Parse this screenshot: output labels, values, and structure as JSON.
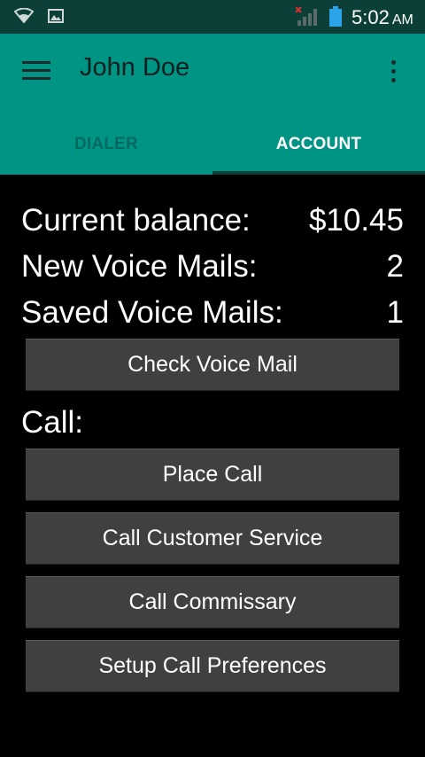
{
  "status_bar": {
    "icons": [
      "wifi-icon",
      "image-icon",
      "signal-icon",
      "battery-icon"
    ],
    "time": "5:02",
    "ampm": "AM"
  },
  "app_bar": {
    "title": "John Doe",
    "menu_icon": "hamburger-menu-icon",
    "overflow_icon": "overflow-menu-icon",
    "background": "#009485"
  },
  "tabs": [
    {
      "label": "DIALER",
      "selected": false
    },
    {
      "label": "ACCOUNT",
      "selected": true
    }
  ],
  "account": {
    "balance_label": "Current balance:",
    "balance_value": "$10.45",
    "new_vm_label": "New Voice Mails:",
    "new_vm_value": "2",
    "saved_vm_label": "Saved Voice Mails:",
    "saved_vm_value": "1",
    "check_vm_button": "Check Voice Mail"
  },
  "call": {
    "section_label": "Call:",
    "buttons": [
      "Place Call",
      "Call Customer Service",
      "Call Commissary",
      "Setup Call Preferences"
    ]
  }
}
